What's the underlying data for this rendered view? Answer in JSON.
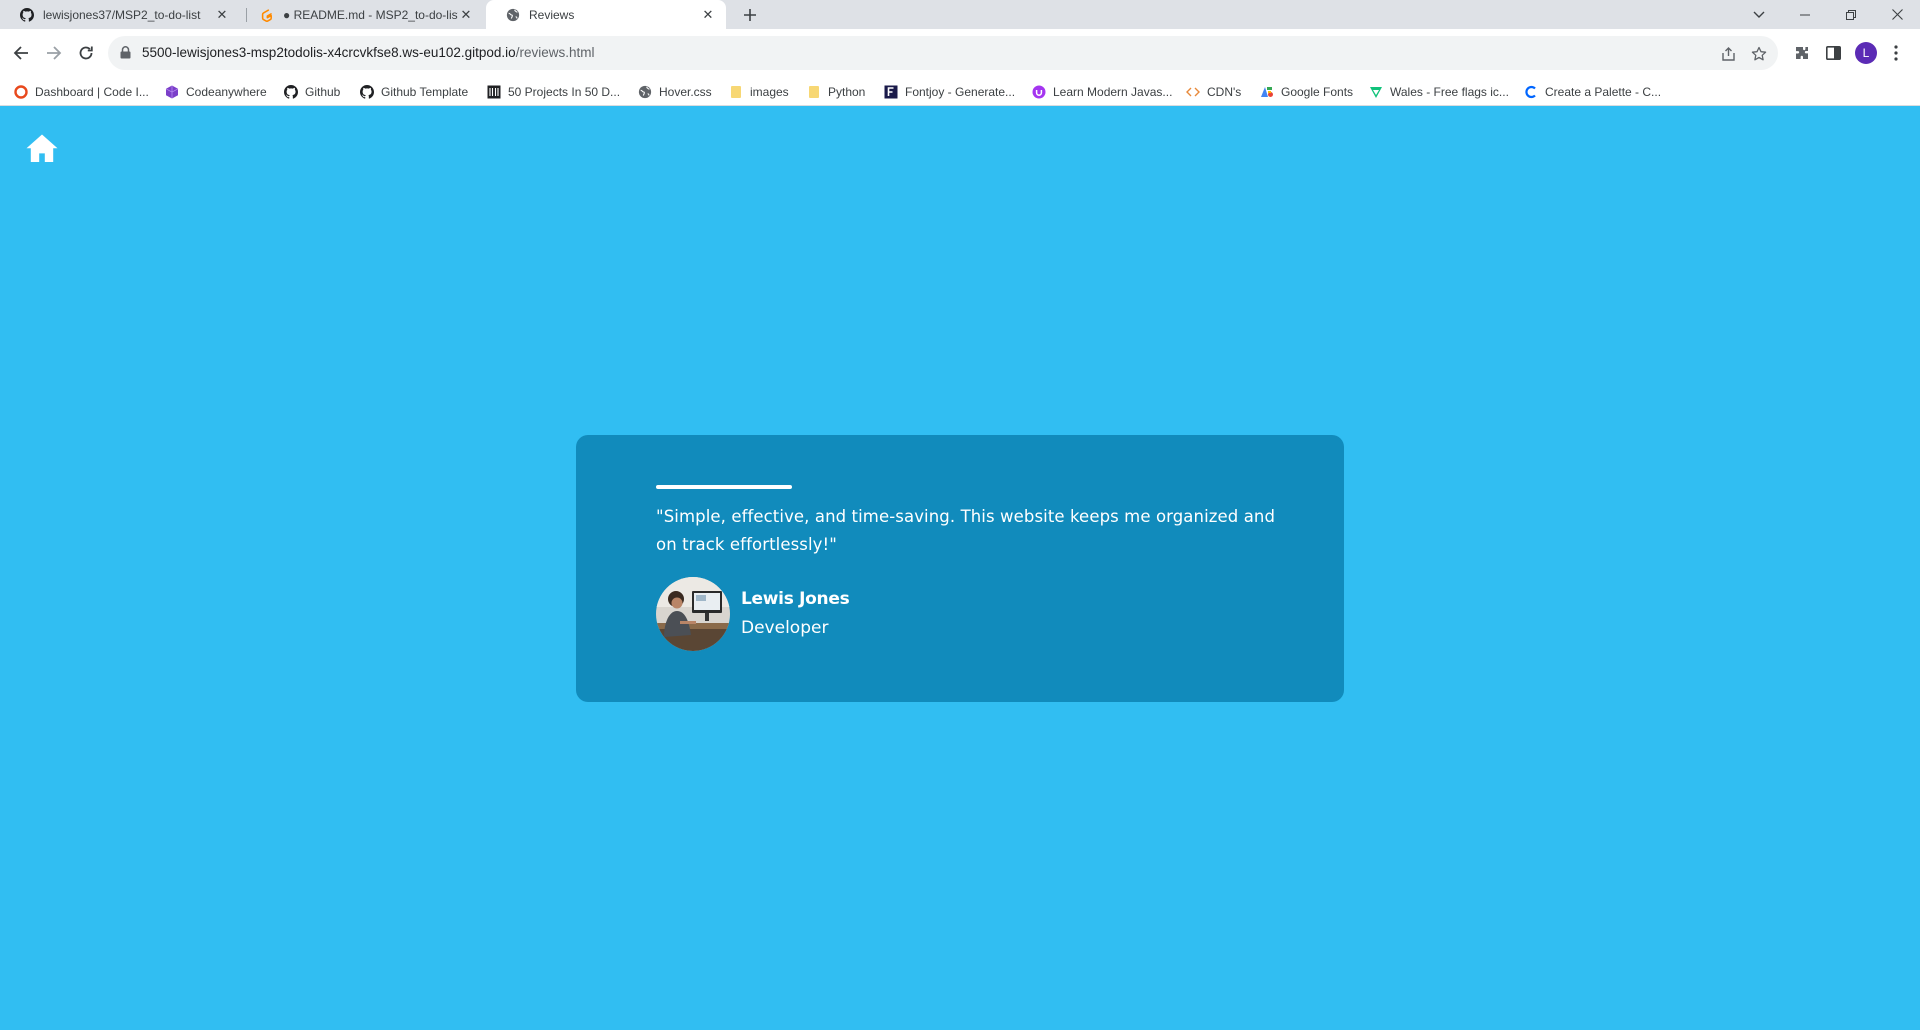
{
  "browser": {
    "tabs": [
      {
        "title": "lewisjones37/MSP2_to-do-list",
        "icon": "github-icon",
        "active": false
      },
      {
        "title": "● README.md - MSP2_to-do-list",
        "icon": "gitpod-icon",
        "active": false
      },
      {
        "title": "Reviews",
        "icon": "globe-icon",
        "active": true
      }
    ],
    "url_host": "5500-lewisjones3-msp2todolis-x4crcvkfse8.ws-eu102.gitpod.io",
    "url_path": "/reviews.html",
    "profile_initial": "L",
    "bookmarks": [
      {
        "label": "Dashboard | Code I...",
        "icon": "codeinstitute-icon"
      },
      {
        "label": "Codeanywhere",
        "icon": "codeanywhere-icon"
      },
      {
        "label": "Github",
        "icon": "github-icon"
      },
      {
        "label": "Github Template",
        "icon": "github-icon"
      },
      {
        "label": "50 Projects In 50 D...",
        "icon": "building-icon"
      },
      {
        "label": "Hover.css",
        "icon": "globe-icon"
      },
      {
        "label": "images",
        "icon": "folder-icon"
      },
      {
        "label": "Python",
        "icon": "folder-icon"
      },
      {
        "label": "Fontjoy - Generate...",
        "icon": "fontjoy-icon"
      },
      {
        "label": "Learn Modern Javas...",
        "icon": "udemy-icon"
      },
      {
        "label": "CDN's",
        "icon": "code-icon"
      },
      {
        "label": "Google Fonts",
        "icon": "googlefonts-icon"
      },
      {
        "label": "Wales - Free flags ic...",
        "icon": "flaticon-icon"
      },
      {
        "label": "Create a Palette - C...",
        "icon": "coolors-icon"
      }
    ]
  },
  "page": {
    "background": "#31bef2",
    "home_icon": "home-icon",
    "review": {
      "quote": "\"Simple, effective, and time-saving. This website keeps me organized and on track effortlessly!\"",
      "name": "Lewis Jones",
      "role": "Developer",
      "card_color": "#118bbc"
    }
  }
}
